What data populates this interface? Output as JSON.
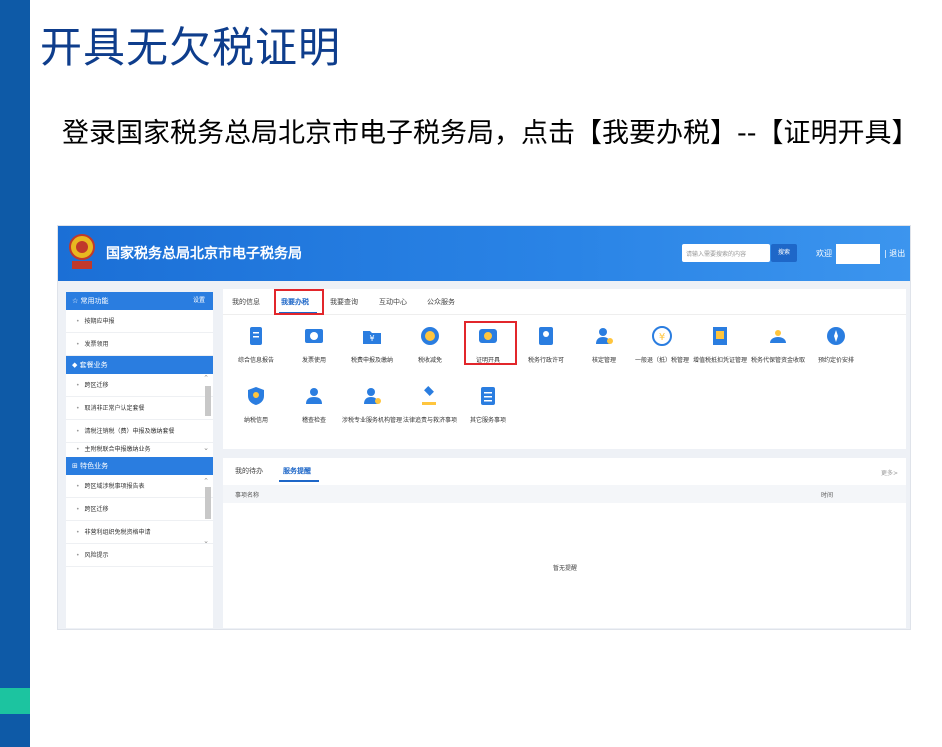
{
  "slide": {
    "title": "开具无欠税证明",
    "body": "登录国家税务总局北京市电子税务局，点击【我要办税】--【证明开具】"
  },
  "portal": {
    "site_name": "国家税务总局北京市电子税务局",
    "search_placeholder": "请输入需要搜索的内容",
    "search_button": "搜索",
    "welcome": "欢迎",
    "logout": "| 退出"
  },
  "sidebar": {
    "common": {
      "title": "常用功能",
      "settings": "设置",
      "items": [
        "按期应申报",
        "发票领用"
      ]
    },
    "package": {
      "title": "套餐业务",
      "items": [
        "跨区迁移",
        "取消非正常户认定套餐",
        "清税注销税（费）申报及缴纳套餐",
        "主附税联合申报缴纳业务"
      ]
    },
    "special": {
      "title": "特色业务",
      "items": [
        "跨区域涉税事项报告表",
        "跨区迁移",
        "非营利组织免税资格申请",
        "风险提示"
      ]
    }
  },
  "main": {
    "tabs": [
      "我的信息",
      "我要办税",
      "我要查询",
      "互动中心",
      "公众服务"
    ],
    "active_tab": "我要办税",
    "icons_row1": [
      {
        "label": "综合信息报告",
        "icon": "report-icon",
        "color": "#2a7de0"
      },
      {
        "label": "发票使用",
        "icon": "invoice-icon",
        "color": "#2a7de0"
      },
      {
        "label": "税费申报及缴纳",
        "icon": "tax-folder-icon",
        "color": "#2a7de0"
      },
      {
        "label": "税收减免",
        "icon": "coin-icon",
        "color": "#2a7de0"
      },
      {
        "label": "证明开具",
        "icon": "certificate-icon",
        "color": "#2a7de0"
      },
      {
        "label": "税务行政许可",
        "icon": "license-icon",
        "color": "#2a7de0"
      },
      {
        "label": "核定管理",
        "icon": "person-gear-icon",
        "color": "#2a7de0"
      },
      {
        "label": "一般退（抵）税管理",
        "icon": "refund-icon",
        "color": "#2a7de0"
      },
      {
        "label": "增值税抵扣凭证管理",
        "icon": "voucher-icon",
        "color": "#2a7de0"
      },
      {
        "label": "税务代保管资金收取",
        "icon": "money-bag-icon",
        "color": "#2a7de0"
      },
      {
        "label": "预约定价安排",
        "icon": "compass-icon",
        "color": "#2a7de0"
      }
    ],
    "icons_row2": [
      {
        "label": "纳税信用",
        "icon": "credit-shield-icon",
        "color": "#2a7de0"
      },
      {
        "label": "稽查检查",
        "icon": "inspector-icon",
        "color": "#2a7de0"
      },
      {
        "label": "涉税专业服务机构管理",
        "icon": "agency-icon",
        "color": "#2a7de0"
      },
      {
        "label": "法律追责与救济事项",
        "icon": "gavel-icon",
        "color": "#2a7de0"
      },
      {
        "label": "其它服务事项",
        "icon": "list-icon",
        "color": "#2a7de0"
      }
    ]
  },
  "todo": {
    "tabs": [
      "我的待办",
      "服务提醒"
    ],
    "active_tab": "服务提醒",
    "more": "更多>",
    "col_name": "事项名称",
    "col_time": "时间",
    "empty": "暂无提醒"
  },
  "colors": {
    "accent": "#1e67c8",
    "highlight": "#e2262b",
    "slide_bar": "#0e5aa7",
    "slide_accent": "#1cc4a0"
  }
}
